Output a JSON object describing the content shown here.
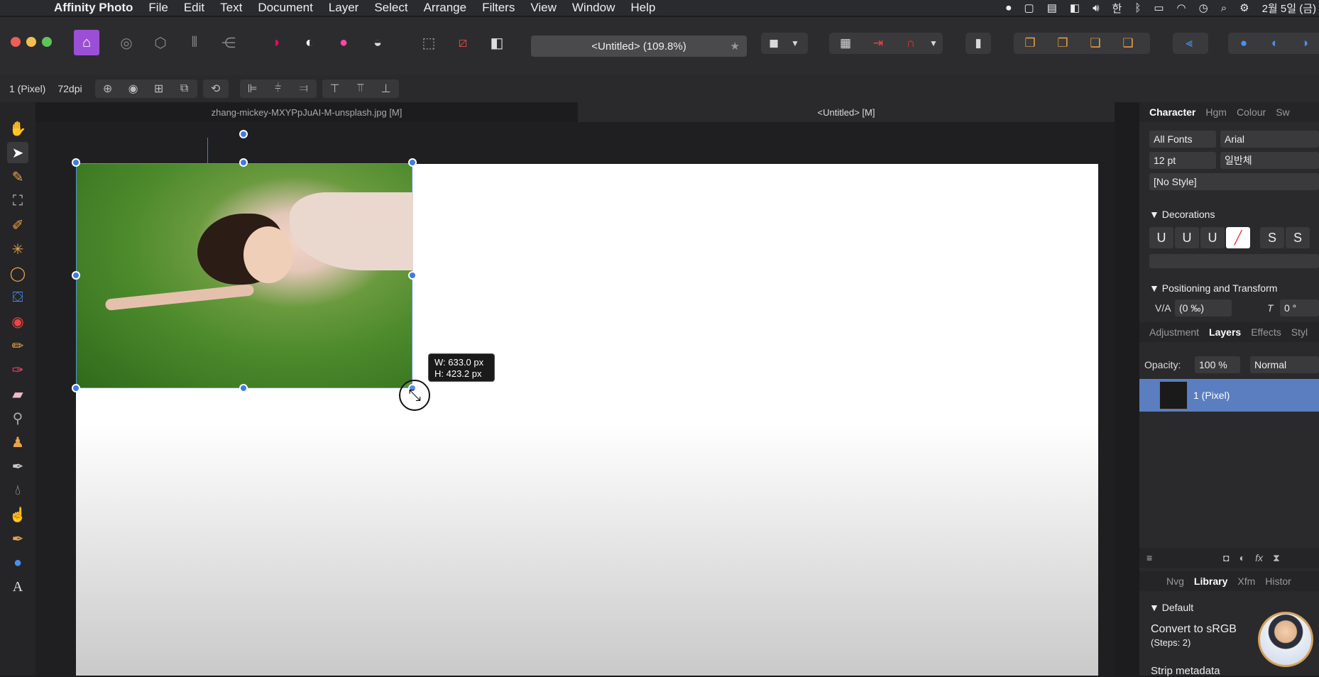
{
  "menubar": {
    "app_name": "Affinity Photo",
    "items": [
      "File",
      "Edit",
      "Text",
      "Document",
      "Layer",
      "Select",
      "Arrange",
      "Filters",
      "View",
      "Window",
      "Help"
    ],
    "status_icons": [
      "record-icon",
      "square-icon",
      "clipboard-icon",
      "window-icon",
      "volume-icon",
      "korean-input-icon",
      "bluetooth-icon",
      "battery-icon",
      "wifi-icon",
      "clock-icon",
      "search-icon",
      "control-center-icon"
    ],
    "input_label": "한",
    "date": "2월 5일 (금)"
  },
  "toolbar": {
    "document_title": "<Untitled> (109.8%)",
    "star": "★"
  },
  "context_bar": {
    "layer_label": "1 (Pixel)",
    "dpi": "72dpi"
  },
  "tabs": [
    {
      "label": "zhang-mickey-MXYPpJuAI-M-unsplash.jpg [M]",
      "active": false
    },
    {
      "label": "<Untitled> [M]",
      "active": true
    }
  ],
  "canvas": {
    "dimension_tooltip_w": "W: 633.0 px",
    "dimension_tooltip_h": "H: 423.2 px"
  },
  "character_panel": {
    "tabs": [
      "Character",
      "Hgm",
      "Colour",
      "Sw"
    ],
    "font_collection": "All Fonts",
    "font_family": "Arial",
    "font_size": "12 pt",
    "font_style": "일반체",
    "text_style": "[No Style]",
    "decorations_label": "Decorations",
    "decoration_buttons": [
      "U",
      "U",
      "U",
      "S",
      "S"
    ],
    "positioning_label": "Positioning and Transform",
    "tracking_value": "(0 ‰)",
    "skew_value": "0 °"
  },
  "layers_panel": {
    "tabs": [
      "Adjustment",
      "Layers",
      "Effects",
      "Styl"
    ],
    "opacity_label": "Opacity:",
    "opacity_value": "100 %",
    "blend_mode": "Normal",
    "layer_name": "1 (Pixel)"
  },
  "library_panel": {
    "tabs": [
      "Nvg",
      "Library",
      "Xfm",
      "Histor"
    ],
    "group_label": "Default",
    "item1": "Convert to sRGB",
    "item1_steps": "(Steps: 2)",
    "item2": "Strip metadata"
  },
  "colors": {
    "selection_blue": "#3f7be0",
    "layer_highlight": "#5a7ec0",
    "affinity_purple": "#9b4fd6"
  }
}
